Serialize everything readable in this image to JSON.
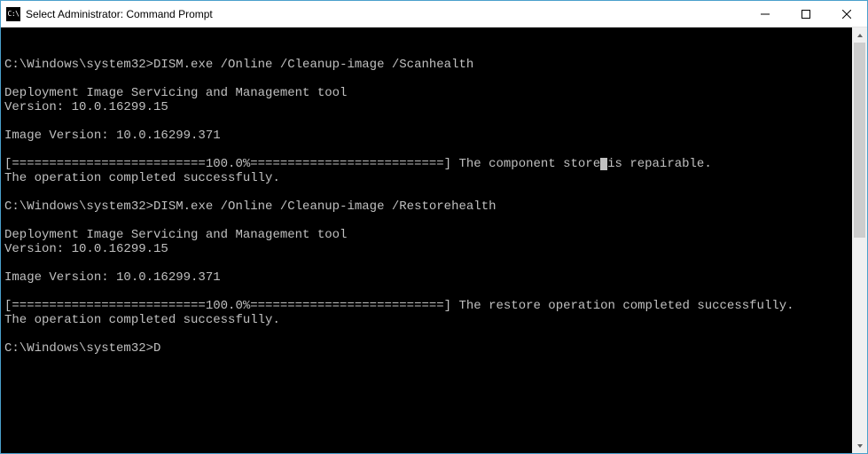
{
  "window": {
    "title": "Select Administrator: Command Prompt",
    "icon_label": "C:\\"
  },
  "terminal": {
    "blank0": "",
    "blank1": "",
    "prompt1": "C:\\Windows\\system32>",
    "cmd1": "DISM.exe /Online /Cleanup-image /Scanhealth",
    "blank2": "",
    "tool_line": "Deployment Image Servicing and Management tool",
    "version_line": "Version: 10.0.16299.15",
    "blank3": "",
    "image_version_line": "Image Version: 10.0.16299.371",
    "blank4": "",
    "progress1a": "[==========================100.0%==========================] The component store",
    "progress1b": "is repairable.",
    "success1": "The operation completed successfully.",
    "blank5": "",
    "prompt2": "C:\\Windows\\system32>",
    "cmd2": "DISM.exe /Online /Cleanup-image /Restorehealth",
    "blank6": "",
    "tool_line2": "Deployment Image Servicing and Management tool",
    "version_line2": "Version: 10.0.16299.15",
    "blank7": "",
    "image_version_line2": "Image Version: 10.0.16299.371",
    "blank8": "",
    "progress2": "[==========================100.0%==========================] The restore operation completed successfully.",
    "success2": "The operation completed successfully.",
    "blank9": "",
    "prompt3": "C:\\Windows\\system32>",
    "input3": "D"
  }
}
